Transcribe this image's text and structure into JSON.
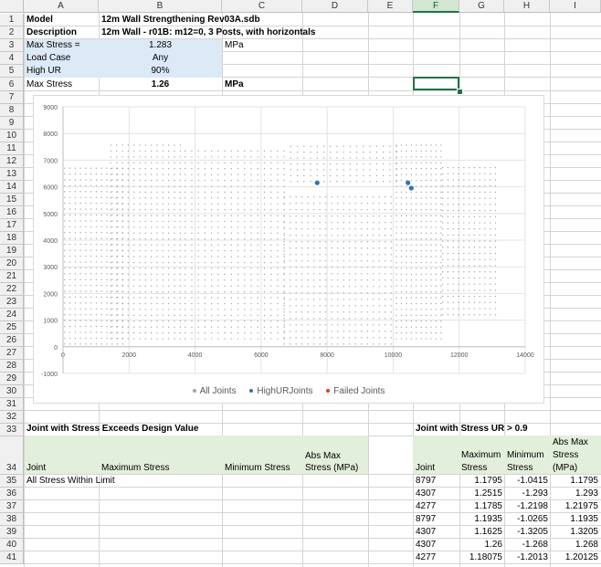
{
  "columns": [
    "A",
    "B",
    "C",
    "D",
    "E",
    "F",
    "G",
    "H",
    "I"
  ],
  "selected_column": "F",
  "row_numbers": [
    "1",
    "2",
    "3",
    "4",
    "5",
    "6",
    "7",
    "8",
    "9",
    "10",
    "11",
    "12",
    "13",
    "14",
    "15",
    "16",
    "17",
    "18",
    "19",
    "20",
    "21",
    "22",
    "23",
    "24",
    "25",
    "26",
    "27",
    "28",
    "29",
    "30",
    "31",
    "32",
    "33",
    "34",
    "35",
    "36",
    "37",
    "38",
    "39",
    "40",
    "41"
  ],
  "header": {
    "model_label": "Model",
    "model_value": "12m Wall Strengthening Rev03A.sdb",
    "description_label": "Description",
    "description_value": "12m Wall - r01B: m12=0, 3 Posts, with horizontals"
  },
  "inputs": {
    "max_stress_label": "Max Stress =",
    "max_stress_value": "1.283",
    "max_stress_unit": "MPa",
    "load_case_label": "Load Case",
    "load_case_value": "Any",
    "high_ur_label": "High UR",
    "high_ur_value": "90%",
    "result_label": "Max Stress",
    "result_value": "1.26",
    "result_unit": "MPa"
  },
  "chart_data": {
    "type": "scatter",
    "xlim": [
      0,
      14000
    ],
    "ylim": [
      -1000,
      9000
    ],
    "x_ticks": [
      "0",
      "2000",
      "4000",
      "6000",
      "8000",
      "10000",
      "12000",
      "14000"
    ],
    "y_ticks": [
      "-1000",
      "0",
      "1000",
      "2000",
      "3000",
      "4000",
      "5000",
      "6000",
      "7000",
      "8000",
      "9000"
    ],
    "grid": true,
    "legend_position": "bottom",
    "series": [
      {
        "name": "All Joints",
        "color": "#a6a6a6",
        "note_visible_only": true
      },
      {
        "name": "HighURJoints",
        "color": "#2e75b6",
        "points": [
          [
            7700,
            6150
          ],
          [
            10450,
            6150
          ],
          [
            10550,
            5950
          ]
        ]
      },
      {
        "name": "Failed Joints",
        "color": "#e03c31",
        "points": []
      }
    ]
  },
  "table_left": {
    "title": "Joint with Stress Exceeds Design Value",
    "headers": {
      "joint": "Joint",
      "max": "Maximum Stress",
      "min": "Minimum Stress",
      "abs1": "Abs Max",
      "abs2": "Stress (MPa)"
    },
    "message": "All Stress Within Limit"
  },
  "table_right": {
    "title": "Joint with Stress UR > 0.9",
    "headers": {
      "joint": "Joint",
      "max1": "Maximum",
      "max2": "Stress",
      "min1": "Minimum",
      "min2": "Stress",
      "abs1": "Abs Max",
      "abs2": "Stress",
      "abs3": "(MPa)"
    },
    "rows": [
      {
        "joint": "8797",
        "max": "1.1795",
        "min": "-1.0415",
        "abs": "1.1795"
      },
      {
        "joint": "4307",
        "max": "1.2515",
        "min": "-1.293",
        "abs": "1.293"
      },
      {
        "joint": "4277",
        "max": "1.1785",
        "min": "-1.2198",
        "abs": "1.21975"
      },
      {
        "joint": "8797",
        "max": "1.1935",
        "min": "-1.0265",
        "abs": "1.1935"
      },
      {
        "joint": "4307",
        "max": "1.1625",
        "min": "-1.3205",
        "abs": "1.3205"
      },
      {
        "joint": "4307",
        "max": "1.26",
        "min": "-1.268",
        "abs": "1.268"
      },
      {
        "joint": "4277",
        "max": "1.18075",
        "min": "-1.2013",
        "abs": "1.20125"
      }
    ]
  }
}
